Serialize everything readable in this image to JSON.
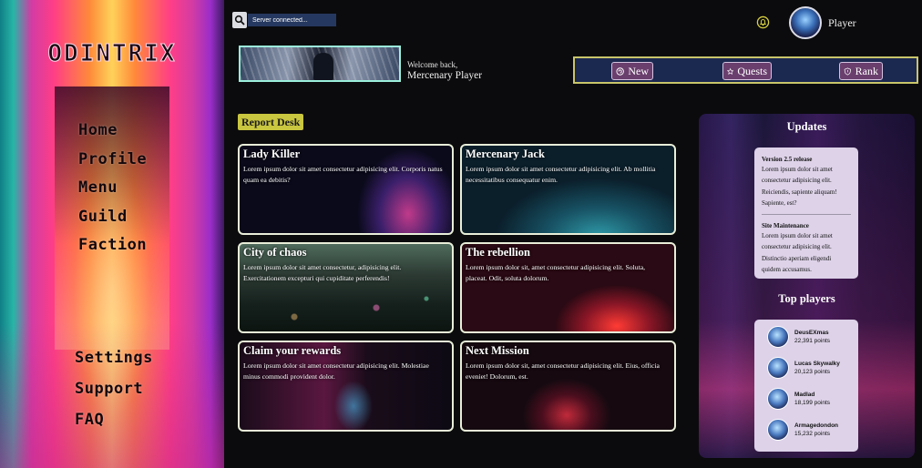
{
  "app": {
    "logo": "ODINTRIX"
  },
  "sidebar": {
    "top_items": [
      {
        "label": "Home"
      },
      {
        "label": "Profile"
      },
      {
        "label": "Menu"
      },
      {
        "label": "Guild"
      },
      {
        "label": "Faction"
      }
    ],
    "bottom_items": [
      {
        "label": "Settings"
      },
      {
        "label": "Support"
      },
      {
        "label": "FAQ"
      }
    ]
  },
  "header": {
    "search": {
      "value": "Server connected...",
      "icon": "search-icon"
    },
    "notification_icon": "bell-icon",
    "user": {
      "name": "Player"
    }
  },
  "welcome": {
    "greeting": "Welcome back,",
    "name": "Mercenary Player"
  },
  "actions": [
    {
      "label": "New",
      "icon": "plus-circle-icon"
    },
    {
      "label": "Quests",
      "icon": "star-icon"
    },
    {
      "label": "Rank",
      "icon": "shield-icon"
    }
  ],
  "report_desk": {
    "label": "Report Desk",
    "cards": [
      {
        "title": "Lady Killer",
        "text": "Lorem ipsum dolor sit amet consectetur adipisicing elit. Corporis natus quam ea debitis?"
      },
      {
        "title": "Mercenary Jack",
        "text": "Lorem ipsum dolor sit amet consectetur adipisicing elit. Ab mollitia necessitatibus consequatur enim."
      },
      {
        "title": "City of chaos",
        "text": "Lorem ipsum dolor sit amet consectetur, adipisicing elit. Exercitationem excepturi qui cupiditate perferendis!"
      },
      {
        "title": "The rebellion",
        "text": "Lorem ipsum dolor sit, amet consectetur adipisicing elit. Soluta, placeat. Odit, soluta dolorum."
      },
      {
        "title": "Claim your rewards",
        "text": "Lorem ipsum dolor sit amet consectetur adipisicing elit. Molestiae minus commodi provident dolor."
      },
      {
        "title": "Next Mission",
        "text": "Lorem ipsum dolor sit, amet consectetur adipisicing elit. Eius, officia eveniet! Dolorum, est."
      }
    ]
  },
  "updates": {
    "heading": "Updates",
    "items": [
      {
        "title": "Version 2.5 release",
        "body": "Lorem ipsum dolor sit amet consectetur adipisicing elit. Reiciendis, sapiente aliquam! Sapiente, est?"
      },
      {
        "title": "Site Maintenance",
        "body": "Lorem ipsum dolor sit amet consectetur adipisicing elit. Distinctio aperiam eligendi quidem accusamus."
      }
    ]
  },
  "top_players": {
    "heading": "Top players",
    "players": [
      {
        "name": "DeusEXmas",
        "points": "22,391 points"
      },
      {
        "name": "Lucas Skywalky",
        "points": "20,123 points"
      },
      {
        "name": "Madlad",
        "points": "18,199 points"
      },
      {
        "name": "Armagedondon",
        "points": "15,232 points"
      }
    ]
  },
  "colors": {
    "accent_yellow": "#c9c63f",
    "action_bar_bg": "#1b2850",
    "button_bg": "#6a3f6e",
    "panel_box": "#ddd2e8"
  }
}
